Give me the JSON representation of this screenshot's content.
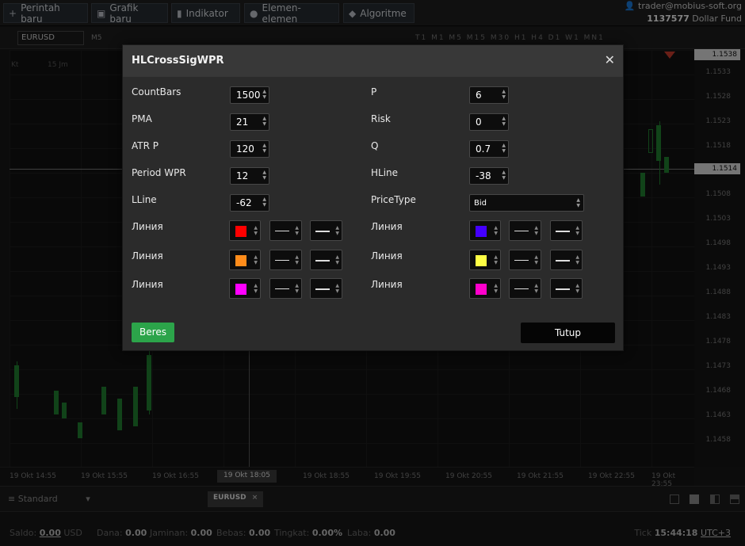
{
  "toolbar": {
    "buttons": [
      {
        "label": "Perintah baru",
        "icon": "plus-icon"
      },
      {
        "label": "Grafik baru",
        "icon": "chart-window-icon"
      },
      {
        "label": "Indikator",
        "icon": "bars-icon"
      },
      {
        "label": "Elemen-elemen",
        "icon": "shapes-icon"
      },
      {
        "label": "Algoritme",
        "icon": "diamond-icon"
      }
    ]
  },
  "account": {
    "email": "trader@mobius-soft.org",
    "number": "1137577",
    "name": "Dollar Fund"
  },
  "chart": {
    "symbol": "EURUSD",
    "timeframe": "M5",
    "timeframes": "T1 M1 M5 M15 M30 H1 H4 D1 W1 MN1",
    "top_labels": [
      "Kt",
      "15 Jm"
    ],
    "price_labels": [
      "1.1533",
      "1.1528",
      "1.1523",
      "1.1518",
      "1.1508",
      "1.1503",
      "1.1498",
      "1.1493",
      "1.1488",
      "1.1483",
      "1.1478",
      "1.1473",
      "1.1468",
      "1.1463",
      "1.1458"
    ],
    "price_tag_top": "1.1538",
    "price_tag_current": "1.1514",
    "time_labels": [
      "19 Okt 14:55",
      "19 Okt 15:55",
      "19 Okt 16:55",
      "19 Okt 18:55",
      "19 Okt 19:55",
      "19 Okt 20:55",
      "19 Okt 21:55",
      "19 Okt 22:55",
      "19 Okt 23:55"
    ],
    "time_tag": "19 Okt 18:05"
  },
  "bottom": {
    "layout_label": "Standard",
    "tab_symbol": "EURUSD"
  },
  "status": {
    "saldo_label": "Saldo:",
    "saldo_value": "0.00",
    "saldo_currency": "USD",
    "dana_label": "Dana:",
    "dana_value": "0.00",
    "jaminan_label": "Jaminan:",
    "jaminan_value": "0.00",
    "bebas_label": "Bebas:",
    "bebas_value": "0.00",
    "tingkat_label": "Tingkat:",
    "tingkat_value": "0.00%",
    "laba_label": "Laba:",
    "laba_value": "0.00",
    "tick_label": "Tick",
    "time": "15:44:18",
    "timezone": "UTC+3"
  },
  "dialog": {
    "title": "HLCrossSigWPR",
    "fields_left": [
      {
        "label": "CountBars",
        "value": "1500"
      },
      {
        "label": "PMA",
        "value": "21"
      },
      {
        "label": "ATR P",
        "value": "120"
      },
      {
        "label": "Period WPR",
        "value": "12"
      },
      {
        "label": "LLine",
        "value": "-62"
      }
    ],
    "fields_right": [
      {
        "label": "P",
        "value": "6"
      },
      {
        "label": "Risk",
        "value": "0"
      },
      {
        "label": "Q",
        "value": "0.7"
      },
      {
        "label": "HLine",
        "value": "-38"
      },
      {
        "label": "PriceType",
        "value": "Bid"
      }
    ],
    "line_label": "Линия",
    "line_colors_left": [
      "#ff0000",
      "#ff8c1a",
      "#ff00ff"
    ],
    "line_colors_right": [
      "#4400ff",
      "#ffff44",
      "#ff00cc"
    ],
    "ok_label": "Beres",
    "cancel_label": "Tutup"
  }
}
